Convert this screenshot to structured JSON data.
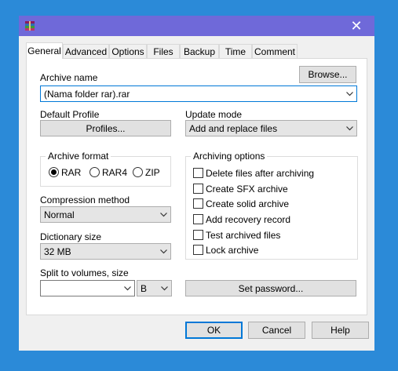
{
  "window": {
    "icon": "winrar-books-icon",
    "close_glyph": "✕"
  },
  "tabs": [
    {
      "label": "General"
    },
    {
      "label": "Advanced"
    },
    {
      "label": "Options"
    },
    {
      "label": "Files"
    },
    {
      "label": "Backup"
    },
    {
      "label": "Time"
    },
    {
      "label": "Comment"
    }
  ],
  "archive_name": {
    "label": "Archive name",
    "browse_label": "Browse...",
    "value": "(Nama folder rar).rar"
  },
  "default_profile": {
    "label": "Default Profile",
    "profiles_label": "Profiles..."
  },
  "update_mode": {
    "label": "Update mode",
    "value": "Add and replace files"
  },
  "archive_format": {
    "label": "Archive format",
    "options": [
      {
        "label": "RAR",
        "selected": true
      },
      {
        "label": "RAR4",
        "selected": false
      },
      {
        "label": "ZIP",
        "selected": false
      }
    ]
  },
  "archiving_options": {
    "label": "Archiving options",
    "items": [
      {
        "label": "Delete files after archiving",
        "checked": false
      },
      {
        "label": "Create SFX archive",
        "checked": false
      },
      {
        "label": "Create solid archive",
        "checked": false
      },
      {
        "label": "Add recovery record",
        "checked": false
      },
      {
        "label": "Test archived files",
        "checked": false
      },
      {
        "label": "Lock archive",
        "checked": false
      }
    ]
  },
  "compression_method": {
    "label": "Compression method",
    "value": "Normal"
  },
  "dictionary_size": {
    "label": "Dictionary size",
    "value": "32 MB"
  },
  "split_volumes": {
    "label": "Split to volumes, size",
    "value": "",
    "unit": "B"
  },
  "set_password_label": "Set password...",
  "footer": {
    "ok_label": "OK",
    "cancel_label": "Cancel",
    "help_label": "Help"
  },
  "colors": {
    "titlebar": "#6f69d9",
    "desktop": "#2b8ad8",
    "focus": "#0078d7"
  }
}
